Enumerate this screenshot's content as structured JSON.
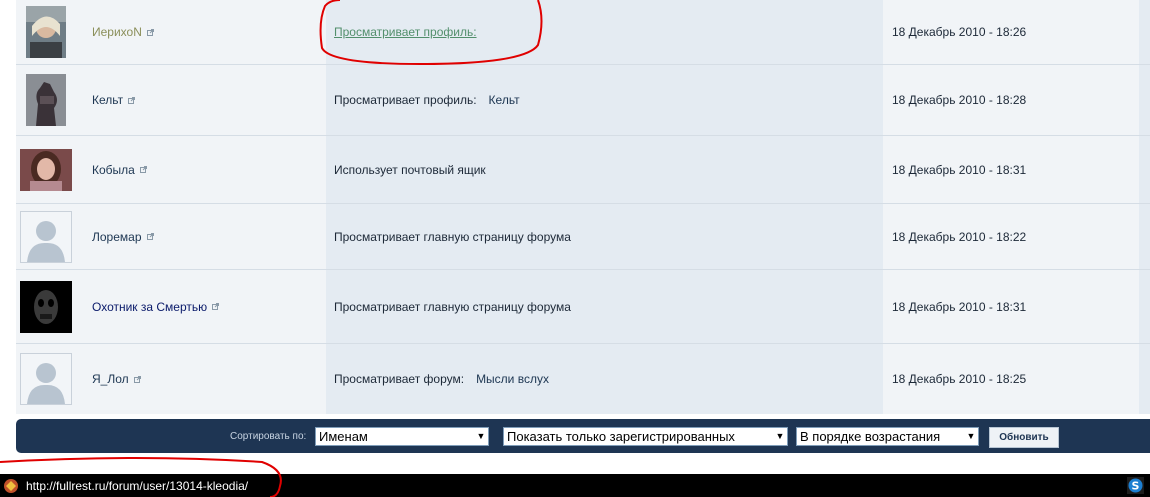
{
  "colors": {
    "accent": "#1e3553",
    "link_visited": "#528f6c",
    "annotation": "#e00000"
  },
  "members": [
    {
      "name": "ИерихоN",
      "name_color": "#8b8f5a",
      "activity": "Просматривает профиль:",
      "activity_link": "",
      "activity_underlined": true,
      "date": "18 Декабрь 2010 - 18:26",
      "avatar": "photo-avatar"
    },
    {
      "name": "Кельт",
      "name_color": "#1d3652",
      "activity": "Просматривает профиль:",
      "activity_link": "Кельт",
      "activity_underlined": false,
      "date": "18 Декабрь 2010 - 18:28",
      "avatar": "statue-avatar"
    },
    {
      "name": "Кобыла",
      "name_color": "#1d3652",
      "activity": "Использует почтовый ящик",
      "activity_link": "",
      "activity_underlined": false,
      "date": "18 Декабрь 2010 - 18:31",
      "avatar": "woman-avatar"
    },
    {
      "name": "Лоремар",
      "name_color": "#1d3652",
      "activity": "Просматривает главную страницу форума",
      "activity_link": "",
      "activity_underlined": false,
      "date": "18 Декабрь 2010 - 18:22",
      "avatar": "default-avatar"
    },
    {
      "name": "Охотник за Смертью",
      "name_color": "#0a1a6a",
      "activity": "Просматривает главную страницу форума",
      "activity_link": "",
      "activity_underlined": false,
      "date": "18 Декабрь 2010 - 18:31",
      "avatar": "skull-avatar"
    },
    {
      "name": "Я_Лол",
      "name_color": "#1d3652",
      "activity": "Просматривает форум:",
      "activity_link": "Мысли вслух",
      "activity_underlined": false,
      "date": "18 Декабрь 2010 - 18:25",
      "avatar": "default-avatar"
    }
  ],
  "sortbar": {
    "label": "Сортировать по:",
    "sort_by": "Именам",
    "filter": "Показать только зарегистрированных",
    "order": "В порядке возрастания",
    "submit": "Обновить"
  },
  "statusbar": {
    "url": "http://fullrest.ru/forum/user/13014-kleodia/"
  }
}
